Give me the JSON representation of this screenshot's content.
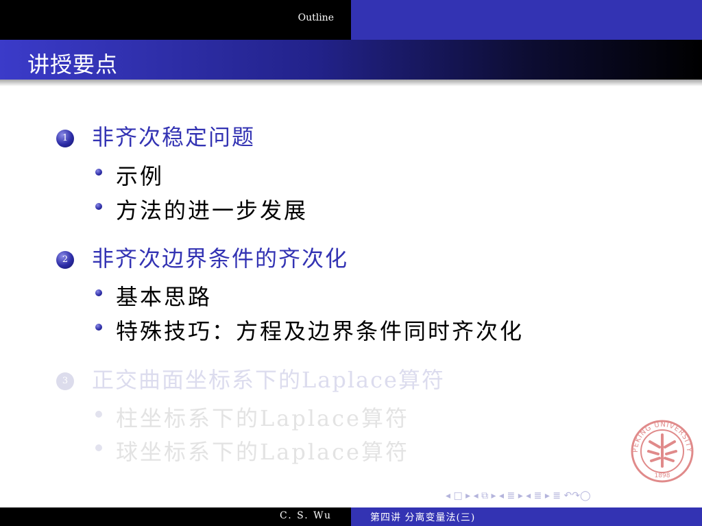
{
  "header": {
    "outline_label": "Outline"
  },
  "frame": {
    "title": "讲授要点"
  },
  "sections": [
    {
      "number": "1",
      "title": "非齐次稳定问题",
      "items": [
        "示例",
        "方法的进一步发展"
      ]
    },
    {
      "number": "2",
      "title": "非齐次边界条件的齐次化",
      "items": [
        "基本思路",
        "特殊技巧：方程及边界条件同时齐次化"
      ]
    },
    {
      "number": "3",
      "title": "正交曲面坐标系下的Laplace算符",
      "items": [
        "柱坐标系下的Laplace算符",
        "球坐标系下的Laplace算符"
      ]
    }
  ],
  "logo": {
    "text": "PEKING UNIVERSITY",
    "year": "1898"
  },
  "nav": {
    "symbols": "◂ □ ▸  ◂ ⧉ ▸  ◂ ≣ ▸  ◂ ≣ ▸   ≣   ↶↷◯"
  },
  "footer": {
    "author": "C. S. Wu",
    "course": "第四讲  分离变量法(三)"
  },
  "colors": {
    "accent": "#3333b3",
    "faded_text": "#e3e3e3",
    "seal": "#e08a8a"
  }
}
